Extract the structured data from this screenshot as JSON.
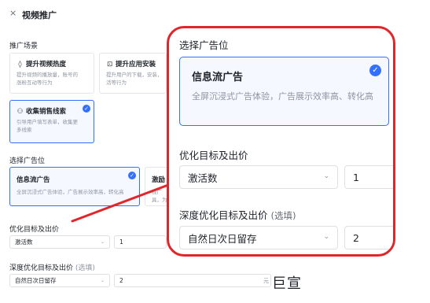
{
  "header": {
    "close_icon": "×",
    "title": "视频推广"
  },
  "scene": {
    "label": "推广场景",
    "cards": [
      {
        "icon": "◊",
        "title": "提升视频热度",
        "desc": [
          "提升视频的播放量，账号的",
          "涨粉互动等行为"
        ]
      },
      {
        "icon": "⊡",
        "title": "提升应用安装",
        "desc": [
          "提升用户的下载，安装，",
          "活等行为"
        ]
      },
      {
        "icon": "⚇",
        "title": "收集销售线索",
        "desc": [
          "引导用户填写表单，收集更",
          "多线索"
        ]
      }
    ]
  },
  "placement": {
    "label": "选择广告位",
    "cards": [
      {
        "title": "信息流广告",
        "desc": "全屏沉浸式广告体验，广告展示效率高，转化高"
      },
      {
        "title": "激励",
        "desc": [
          "视广",
          "具，为"
        ]
      }
    ]
  },
  "goal": {
    "label": "优化目标及出价",
    "select_value": "激活数",
    "bid_value": "1"
  },
  "deep": {
    "label": "深度优化目标及出价",
    "optional": "(选填)",
    "select_value": "自然日次日留存",
    "bid_value": "2",
    "unit": "元"
  },
  "zoom": {
    "placement_label": "选择广告位",
    "card_title": "信息流广告",
    "card_desc": "全屏沉浸式广告体验，广告展示效率高、转化高",
    "goal_label": "优化目标及出价",
    "goal_select": "激活数",
    "goal_bid": "1",
    "deep_label": "深度优化目标及出价",
    "deep_optional": "(选填)",
    "deep_select": "自然日次日留存",
    "deep_bid": "2"
  },
  "watermark": "巨宣",
  "colors": {
    "accent": "#3370ff",
    "highlight": "#e0262a"
  }
}
